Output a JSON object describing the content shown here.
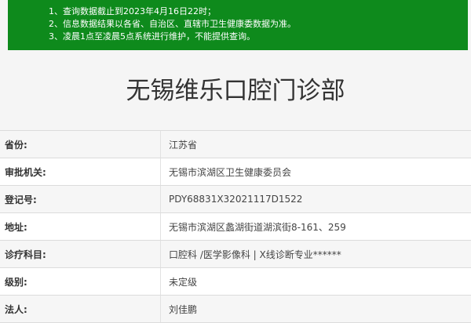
{
  "notice": {
    "lines": [
      "1、查询数据截止到2023年4月16日22时；",
      "2、信息数据结果以各省、自治区、直辖市卫生健康委数据为准。",
      "3、凌晨1点至凌晨5点系统进行维护，不能提供查询。"
    ]
  },
  "title": "无锡维乐口腔门诊部",
  "rows": [
    {
      "label": "省份:",
      "value": "江苏省"
    },
    {
      "label": "审批机关:",
      "value": "无锡市滨湖区卫生健康委员会"
    },
    {
      "label": "登记号:",
      "value": "PDY68831X32021117D1522"
    },
    {
      "label": "地址:",
      "value": "无锡市滨湖区蠡湖街道湖滨街8-161、259"
    },
    {
      "label": "诊疗科目:",
      "value": "口腔科 /医学影像科 | X线诊断专业******"
    },
    {
      "label": "级别:",
      "value": "未定级"
    },
    {
      "label": "法人:",
      "value": "刘佳鹏"
    }
  ],
  "colors": {
    "notice_bg": "#0e8a1c",
    "notice_text": "#ffffff"
  }
}
